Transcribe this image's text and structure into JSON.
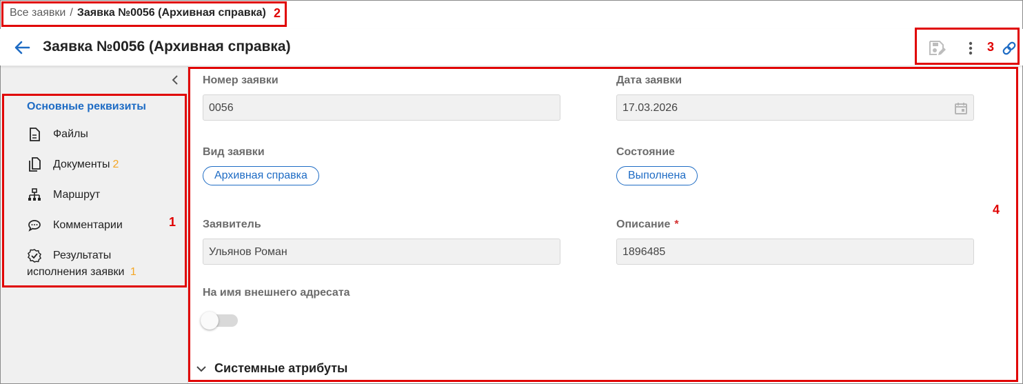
{
  "breadcrumb": {
    "root": "Все заявки",
    "separator": "/",
    "current": "Заявка №0056 (Архивная справка)"
  },
  "header": {
    "title": "Заявка №0056 (Архивная справка)",
    "icons": [
      "back-arrow-icon",
      "save-edit-icon",
      "more-vertical-icon",
      "link-icon"
    ]
  },
  "sidebar": {
    "main_item": "Основные реквизиты",
    "items": [
      {
        "label": "Файлы",
        "badge": "",
        "icon": "file-icon"
      },
      {
        "label": "Документы",
        "badge": "2",
        "icon": "documents-icon"
      },
      {
        "label": "Маршрут",
        "badge": "",
        "icon": "route-icon"
      },
      {
        "label": "Комментарии",
        "badge": "",
        "icon": "comment-icon"
      }
    ],
    "results": {
      "line1": "Результаты",
      "line2": "исполнения заявки",
      "badge": "1",
      "icon": "verified-icon"
    }
  },
  "form": {
    "number_label": "Номер заявки",
    "number_value": "0056",
    "date_label": "Дата заявки",
    "date_value": "17.03.2026",
    "type_label": "Вид заявки",
    "type_value": "Архивная справка",
    "state_label": "Состояние",
    "state_value": "Выполнена",
    "applicant_label": "Заявитель",
    "applicant_value": "Ульянов Роман",
    "description_label": "Описание",
    "required_mark": "*",
    "description_value": "1896485",
    "external_label": "На имя внешнего адресата",
    "external_enabled": false,
    "system_section": "Системные атрибуты"
  },
  "annotations": [
    "1",
    "2",
    "3",
    "4"
  ],
  "colors": {
    "accent": "#1d6bc4",
    "badge": "#f5a623",
    "annotation": "#e00000",
    "sidebar_bg": "#f0f0f0",
    "field_bg": "#f1f1f1"
  }
}
